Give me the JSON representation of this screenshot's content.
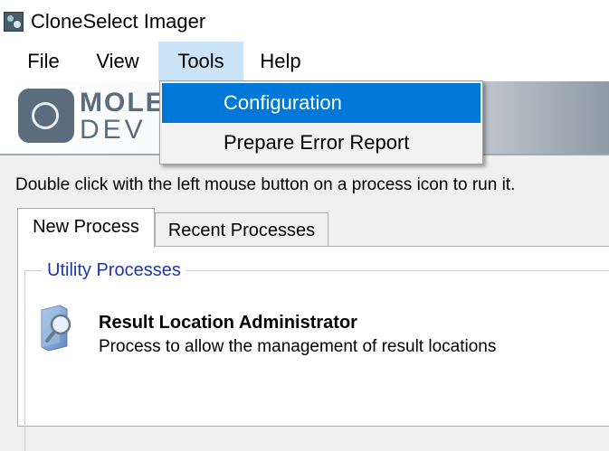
{
  "window": {
    "title": "CloneSelect Imager",
    "app_icon": "cloneselect-app-icon"
  },
  "menubar": {
    "items": [
      {
        "label": "File"
      },
      {
        "label": "View"
      },
      {
        "label": "Tools"
      },
      {
        "label": "Help"
      }
    ],
    "active": "Tools"
  },
  "banner": {
    "logo_top": "MOLEC",
    "logo_bottom": "DEV"
  },
  "tools_menu": {
    "items": [
      {
        "label": "Configuration",
        "selected": true
      },
      {
        "label": "Prepare Error Report",
        "selected": false
      }
    ]
  },
  "instruction": "Double click with the left mouse button on a process icon to run it.",
  "tabs": [
    {
      "label": "New Process",
      "active": true
    },
    {
      "label": "Recent Processes",
      "active": false
    }
  ],
  "group": {
    "label": "Utility Processes",
    "process": {
      "title": "Result Location Administrator",
      "description": "Process to allow the management of result locations",
      "icon": "result-location-icon"
    }
  },
  "colors": {
    "accent": "#0078d7",
    "menu_active_bg": "#cce4f7",
    "group_label": "#1a37b0"
  }
}
